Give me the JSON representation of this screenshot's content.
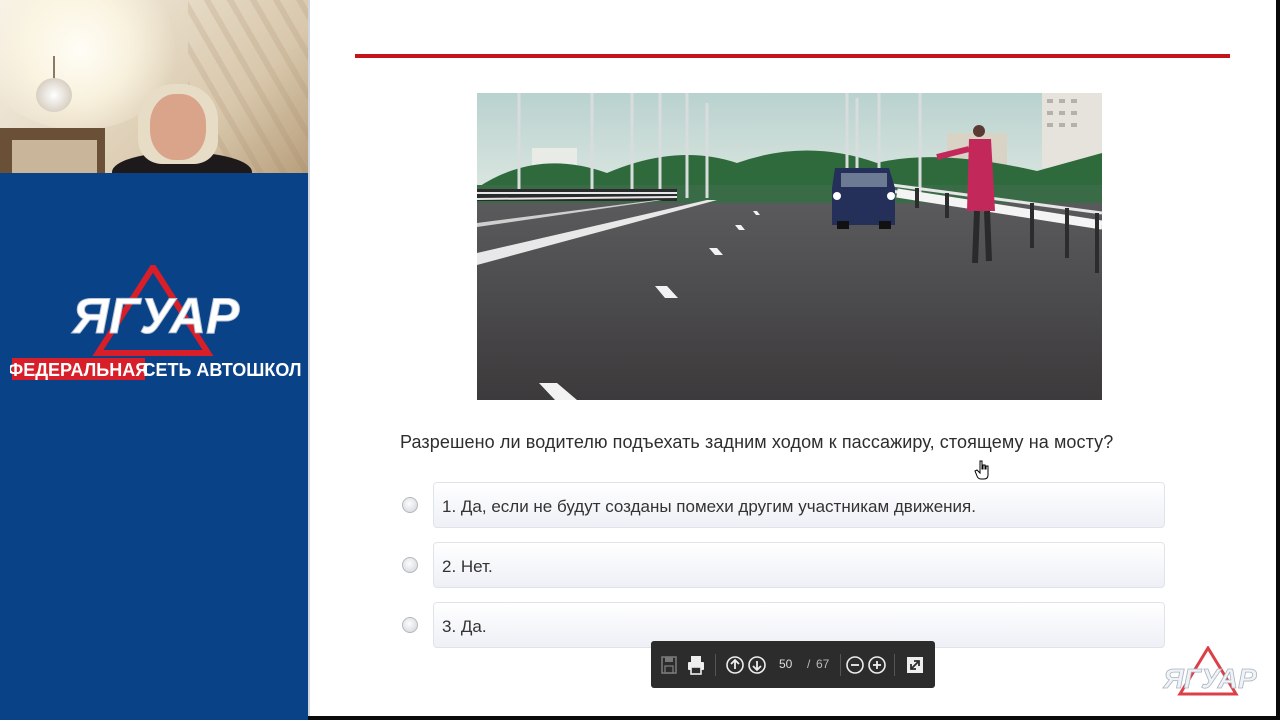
{
  "brand": {
    "logo_main": "ЯГУАР",
    "tagline_red": "ФЕДЕРАЛЬНАЯ",
    "tagline_white": "СЕТЬ АВТОШКОЛ",
    "panel_color": "#0a4288",
    "accent_red": "#d81e28"
  },
  "slide": {
    "rule_color": "#c4141c",
    "question": "Разрешено ли водителю подъехать задним ходом к пассажиру, стоящему на мосту?",
    "options": [
      {
        "label": "1. Да, если не будут созданы помехи другим участникам движения."
      },
      {
        "label": "2. Нет."
      },
      {
        "label": "3. Да."
      }
    ],
    "watermark_text": "ЯГУАР"
  },
  "toolbar": {
    "icons": [
      "save-icon",
      "print-icon",
      "arrow-up-icon",
      "arrow-down-icon",
      "zoom-out-icon",
      "zoom-in-icon",
      "fit-page-icon"
    ],
    "current_page": "50",
    "separator": "/",
    "total_pages": "67"
  }
}
